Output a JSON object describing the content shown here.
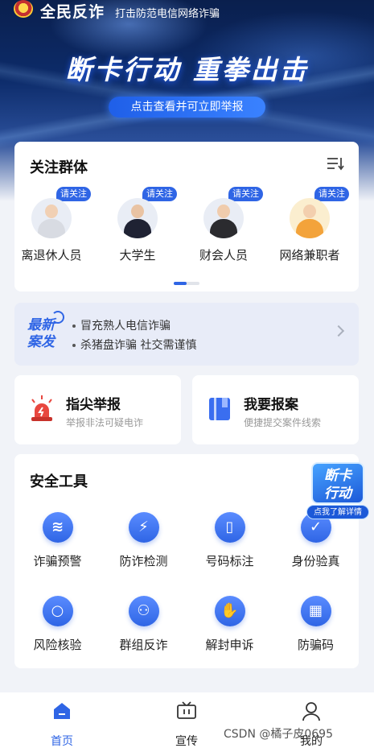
{
  "header": {
    "app_name": "全民反诈",
    "slogan": "打击防范电信网络诈骗",
    "banner_title": "断卡行动 重拳出击",
    "banner_cta": "点击查看并可立即举报"
  },
  "focus_groups": {
    "title": "关注群体",
    "tag": "请关注",
    "items": [
      {
        "label": "离退休人员",
        "tag": "请关注"
      },
      {
        "label": "大学生",
        "tag": "请关注"
      },
      {
        "label": "财会人员",
        "tag": "请关注"
      },
      {
        "label": "网络兼职者",
        "tag": "请关注"
      }
    ]
  },
  "latest_cases": {
    "badge": "最新案发",
    "badge_line1": "最新",
    "badge_line2": "案发",
    "items": [
      "冒充熟人电信诈骗",
      "杀猪盘诈骗 社交需谨慎"
    ]
  },
  "reports": [
    {
      "title": "指尖举报",
      "subtitle": "举报非法可疑电诈"
    },
    {
      "title": "我要报案",
      "subtitle": "便捷提交案件线索"
    }
  ],
  "safety_tools": {
    "title": "安全工具",
    "items": [
      {
        "label": "诈骗预警",
        "icon": "layers-icon"
      },
      {
        "label": "防诈检测",
        "icon": "shield-bolt-icon"
      },
      {
        "label": "号码标注",
        "icon": "phone-icon"
      },
      {
        "label": "身份验真",
        "icon": "id-verify-icon"
      },
      {
        "label": "风险核验",
        "icon": "search-icon"
      },
      {
        "label": "群组反诈",
        "icon": "group-icon"
      },
      {
        "label": "解封申诉",
        "icon": "hand-icon"
      },
      {
        "label": "防骗码",
        "icon": "qr-code-icon"
      }
    ]
  },
  "floating_badge": {
    "line1": "断卡",
    "line2": "行动",
    "pill": "点我了解详情"
  },
  "bottom_nav": [
    {
      "label": "首页",
      "active": true
    },
    {
      "label": "宣传",
      "active": false
    },
    {
      "label": "我的",
      "active": false
    }
  ],
  "watermark": "CSDN @橘子皮0695",
  "colors": {
    "accent": "#2f65e5",
    "report_red": "#e8473f",
    "background": "#f1f3f8"
  }
}
